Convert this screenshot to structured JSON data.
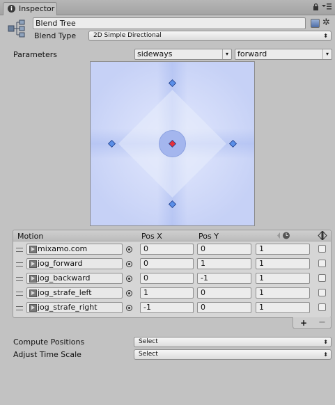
{
  "tab": {
    "title": "Inspector",
    "icon": "info-icon",
    "menu_icons": [
      "lock-icon",
      "tab-menu-icon"
    ]
  },
  "header": {
    "icon": "blend-tree-icon",
    "name_value": "Blend Tree",
    "blend_type_label": "Blend Type",
    "blend_type_value": "2D Simple Directional"
  },
  "parameters": {
    "label": "Parameters",
    "x_param": "sideways",
    "y_param": "forward"
  },
  "plot": {
    "points": [
      {
        "motion": "mixamo.com",
        "x": 0,
        "y": 0,
        "active": true
      },
      {
        "motion": "jog_forward",
        "x": 0,
        "y": 1,
        "active": false
      },
      {
        "motion": "jog_backward",
        "x": 0,
        "y": -1,
        "active": false
      },
      {
        "motion": "jog_strafe_left",
        "x": 1,
        "y": 0,
        "active": false
      },
      {
        "motion": "jog_strafe_right",
        "x": -1,
        "y": 0,
        "active": false
      }
    ],
    "colors": {
      "point": "#5b8fe8",
      "active": "#e8303a"
    }
  },
  "motion_list": {
    "headers": {
      "motion": "Motion",
      "pos_x": "Pos X",
      "pos_y": "Pos Y"
    },
    "rows": [
      {
        "motion": "mixamo.com",
        "pos_x": "0",
        "pos_y": "0",
        "speed": "1"
      },
      {
        "motion": "jog_forward",
        "pos_x": "0",
        "pos_y": "1",
        "speed": "1"
      },
      {
        "motion": "jog_backward",
        "pos_x": "0",
        "pos_y": "-1",
        "speed": "1"
      },
      {
        "motion": "jog_strafe_left",
        "pos_x": "1",
        "pos_y": "0",
        "speed": "1"
      },
      {
        "motion": "jog_strafe_right",
        "pos_x": "-1",
        "pos_y": "0",
        "speed": "1"
      }
    ],
    "footer": {
      "add": "+",
      "remove": "−"
    }
  },
  "settings": {
    "compute_positions_label": "Compute Positions",
    "compute_positions_value": "Select",
    "adjust_time_scale_label": "Adjust Time Scale",
    "adjust_time_scale_value": "Select"
  }
}
